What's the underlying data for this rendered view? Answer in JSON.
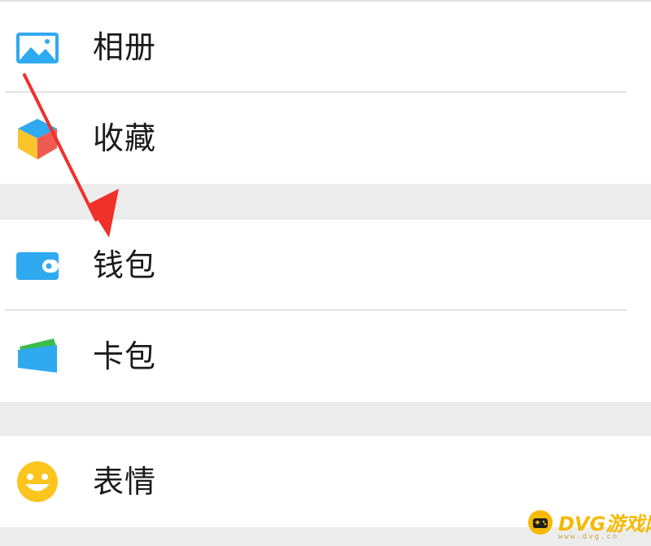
{
  "menu": {
    "items": [
      {
        "label": "相册",
        "icon": "photo-album-icon"
      },
      {
        "label": "收藏",
        "icon": "favorites-cube-icon"
      },
      {
        "label": "钱包",
        "icon": "wallet-icon"
      },
      {
        "label": "卡包",
        "icon": "card-pack-icon"
      },
      {
        "label": "表情",
        "icon": "sticker-smiley-icon"
      }
    ]
  },
  "annotation": {
    "type": "red-arrow",
    "points_to": "钱包",
    "color": "#f0302a"
  },
  "watermark": {
    "title": "DVG游戏网",
    "subtitle": "www.dvg.cn",
    "color": "#f5b900"
  },
  "colors": {
    "background": "#ececec",
    "row": "#ffffff",
    "divider": "#e3e3e3",
    "text": "#1b1b1b",
    "icon_blue": "#2fa9ef"
  }
}
